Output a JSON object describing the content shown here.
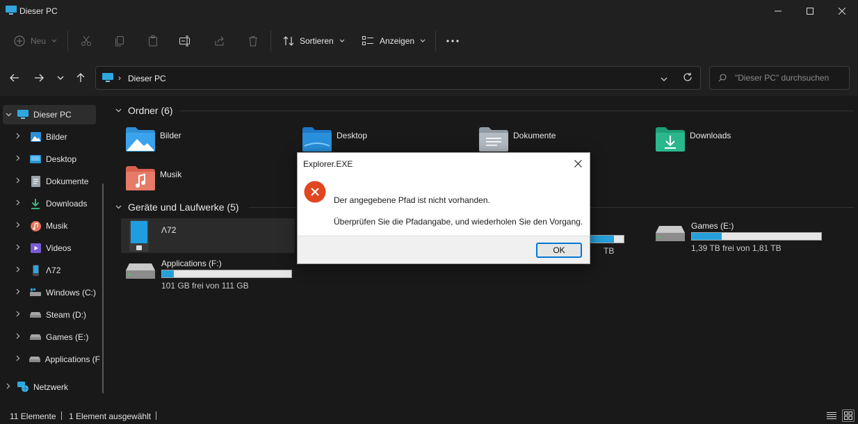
{
  "window": {
    "title": "Dieser PC",
    "icon": "monitor-icon",
    "controls": [
      "minimize-icon",
      "maximize-icon",
      "close-icon"
    ]
  },
  "commandbar": {
    "new_label": "Neu",
    "sort_label": "Sortieren",
    "view_label": "Anzeigen",
    "disabled_actions": [
      "cut-icon",
      "copy-icon",
      "paste-icon",
      "rename-icon",
      "share-icon",
      "delete-icon"
    ]
  },
  "address": {
    "crumb": "Dieser PC",
    "separator": "›"
  },
  "search": {
    "placeholder": "\"Dieser PC\" durchsuchen"
  },
  "sidebar": {
    "items": [
      {
        "label": "Dieser PC",
        "icon": "monitor-icon",
        "expanded": true,
        "selected": true
      },
      {
        "label": "Bilder",
        "icon": "pictures-icon"
      },
      {
        "label": "Desktop",
        "icon": "desktop-icon"
      },
      {
        "label": "Dokumente",
        "icon": "documents-icon"
      },
      {
        "label": "Downloads",
        "icon": "download-icon"
      },
      {
        "label": "Musik",
        "icon": "music-icon"
      },
      {
        "label": "Videos",
        "icon": "videos-icon"
      },
      {
        "label": "Λ72",
        "icon": "phone-icon"
      },
      {
        "label": "Windows (C:)",
        "icon": "windows-drive-icon"
      },
      {
        "label": "Steam (D:)",
        "icon": "drive-icon"
      },
      {
        "label": "Games (E:)",
        "icon": "drive-icon"
      },
      {
        "label": "Applications (F",
        "icon": "drive-icon"
      },
      {
        "label": "Netzwerk",
        "icon": "network-icon"
      }
    ]
  },
  "content": {
    "folders_header": "Ordner (6)",
    "folders": [
      {
        "label": "Bilder",
        "icon": "pictures-folder-icon"
      },
      {
        "label": "Desktop",
        "icon": "desktop-folder-icon"
      },
      {
        "label": "Dokumente",
        "icon": "documents-folder-icon"
      },
      {
        "label": "Downloads",
        "icon": "downloads-folder-icon"
      },
      {
        "label": "Musik",
        "icon": "music-folder-icon"
      }
    ],
    "devices_header": "Geräte und Laufwerke (5)",
    "devices": {
      "phone": {
        "label": "Λ72"
      },
      "partial_drive": {
        "free_suffix": "TB",
        "used_fraction": 0.82
      },
      "games": {
        "label": "Games (E:)",
        "free": "1,39 TB frei von 1,81 TB",
        "used_fraction": 0.23
      },
      "applications": {
        "label": "Applications (F:)",
        "free": "101 GB frei von 111 GB",
        "used_fraction": 0.09
      }
    },
    "accent_color": "#26a0da"
  },
  "statusbar": {
    "count": "11 Elemente",
    "selection": "1 Element ausgewählt"
  },
  "dialog": {
    "title": "Explorer.EXE",
    "message": "Der angegebene Pfad ist nicht vorhanden.",
    "detail": "Überprüfen Sie die Pfadangabe, und wiederholen Sie den Vorgang.",
    "ok_label": "OK",
    "icon": "error-icon",
    "error_color": "#e0461f"
  }
}
